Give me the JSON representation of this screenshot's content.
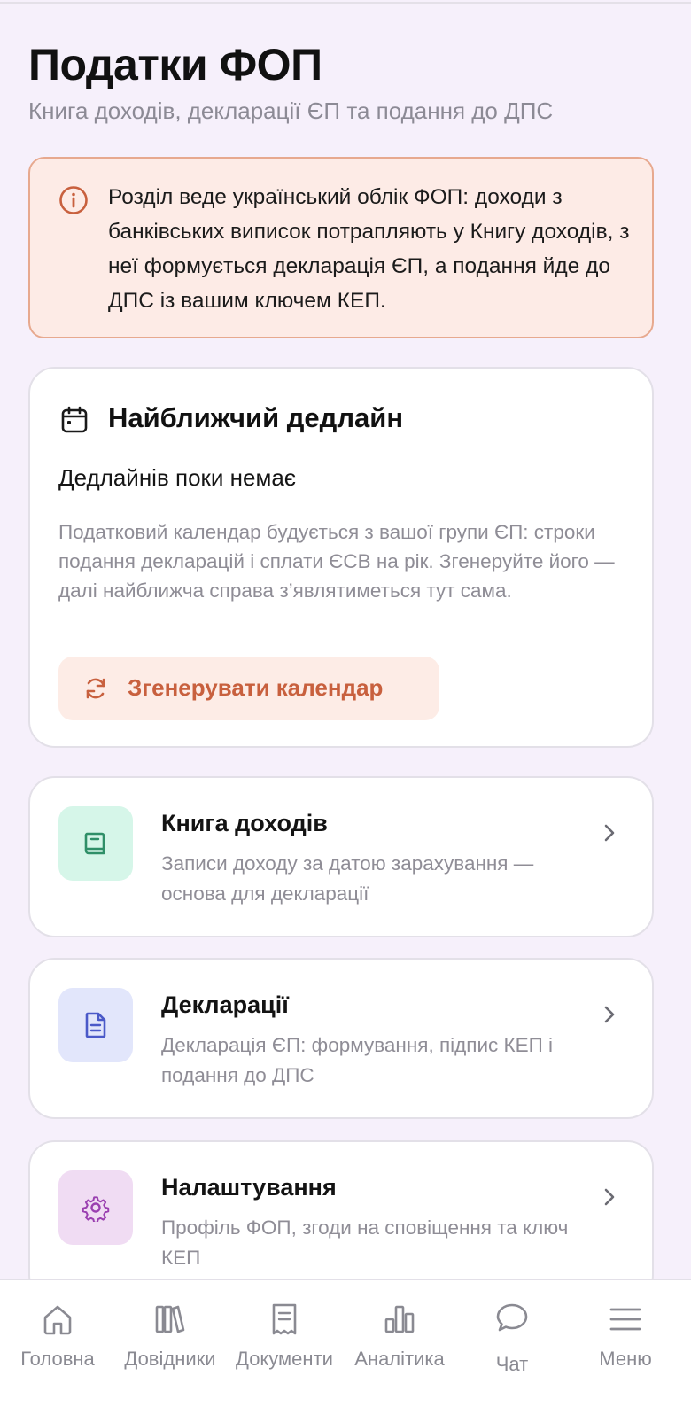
{
  "header": {
    "title": "Податки ФОП",
    "subtitle": "Книга доходів, декларації ЄП та подання до ДПС"
  },
  "info_banner": {
    "icon": "info-icon",
    "text": "Розділ веде український облік ФОП: доходи з банківських виписок потрапляють у Книгу доходів, з неї формується декларація ЄП, а подання йде до ДПС із вашим ключем КЕП."
  },
  "deadline_card": {
    "icon": "calendar-icon",
    "title": "Найближчий дедлайн",
    "state": "Дедлайнів поки немає",
    "description": "Податковий календар будується з вашої групи ЄП: строки подання декларацій і сплати ЄСВ на рік. Згенеруйте його — далі найближча справа з’являтиметься тут сама.",
    "button_label": "Згенерувати календар",
    "button_icon": "refresh-icon"
  },
  "sections": [
    {
      "title": "Книга доходів",
      "description": "Записи доходу за датою зарахування — основа для декларації",
      "icon": "book-icon",
      "color": "#d6f6e9"
    },
    {
      "title": "Декларації",
      "description": "Декларація ЄП: формування, підпис КЕП і подання до ДПС",
      "icon": "document-icon",
      "color": "#e2e6fb"
    },
    {
      "title": "Налаштування",
      "description": "Профіль ФОП, згоди на сповіщення та ключ КЕП",
      "icon": "gear-icon",
      "color": "#f0dcf3"
    }
  ],
  "bottom_nav": {
    "items": [
      {
        "label": "Головна",
        "icon": "home-icon"
      },
      {
        "label": "Довідники",
        "icon": "library-icon"
      },
      {
        "label": "Документи",
        "icon": "receipt-icon"
      },
      {
        "label": "Аналітика",
        "icon": "bar-chart-icon"
      },
      {
        "label": "Чат",
        "icon": "chat-icon"
      },
      {
        "label": "Меню",
        "icon": "menu-icon"
      }
    ]
  },
  "colors": {
    "accent": "#c8603e",
    "background": "#f6f0fb",
    "muted_text": "#8f8d96"
  }
}
